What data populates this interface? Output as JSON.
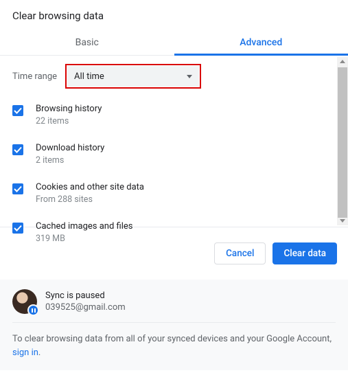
{
  "title": "Clear browsing data",
  "tabs": {
    "basic": "Basic",
    "advanced": "Advanced"
  },
  "timerange": {
    "label": "Time range",
    "value": "All time"
  },
  "items": [
    {
      "label": "Browsing history",
      "sub": "22 items"
    },
    {
      "label": "Download history",
      "sub": "2 items"
    },
    {
      "label": "Cookies and other site data",
      "sub": "From 288 sites"
    },
    {
      "label": "Cached images and files",
      "sub": "319 MB"
    }
  ],
  "buttons": {
    "cancel": "Cancel",
    "clear": "Clear data"
  },
  "sync": {
    "status": "Sync is paused",
    "email": "039525@gmail.com",
    "message": "To clear browsing data from all of your synced devices and your Google Account, ",
    "signin": "sign in"
  }
}
